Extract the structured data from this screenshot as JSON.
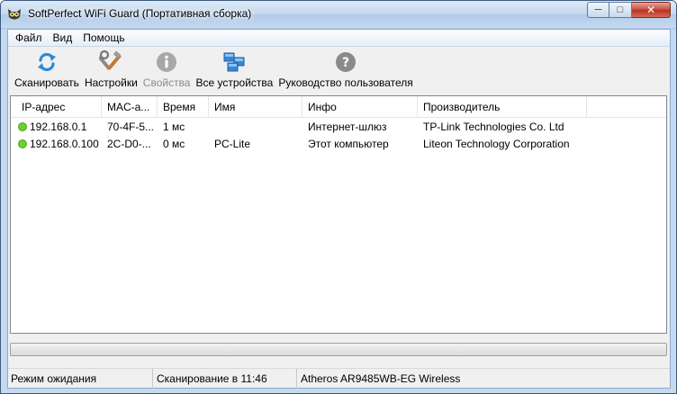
{
  "window": {
    "title": "SoftPerfect WiFi Guard (Портативная сборка)",
    "minimize_label": "─",
    "maximize_label": "□",
    "close_label": "✕"
  },
  "menu": {
    "items": [
      {
        "label": "Файл"
      },
      {
        "label": "Вид"
      },
      {
        "label": "Помощь"
      }
    ]
  },
  "toolbar": {
    "scan_label": "Сканировать",
    "settings_label": "Настройки",
    "properties_label": "Свойства",
    "all_devices_label": "Все устройства",
    "manual_label": "Руководство пользователя"
  },
  "table": {
    "columns": [
      {
        "label": "IP-адрес"
      },
      {
        "label": "MAC-а..."
      },
      {
        "label": "Время"
      },
      {
        "label": "Имя"
      },
      {
        "label": "Инфо"
      },
      {
        "label": "Производитель"
      }
    ],
    "rows": [
      {
        "ip": "192.168.0.1",
        "mac": "70-4F-5...",
        "time": "1 мс",
        "name": "",
        "info": "Интернет-шлюз",
        "vendor": "TP-Link Technologies Co. Ltd"
      },
      {
        "ip": "192.168.0.100",
        "mac": "2C-D0-...",
        "time": "0 мс",
        "name": "PC-Lite",
        "info": "Этот компьютер",
        "vendor": "Liteon Technology Corporation"
      }
    ]
  },
  "status": {
    "state": "Режим ожидания",
    "last_scan": "Сканирование в 11:46",
    "adapter": "Atheros AR9485WB-EG Wireless"
  },
  "colors": {
    "online_dot": "#6fcf2f",
    "refresh_icon": "#2a8ad8",
    "help_icon": "#8a8a8a"
  }
}
